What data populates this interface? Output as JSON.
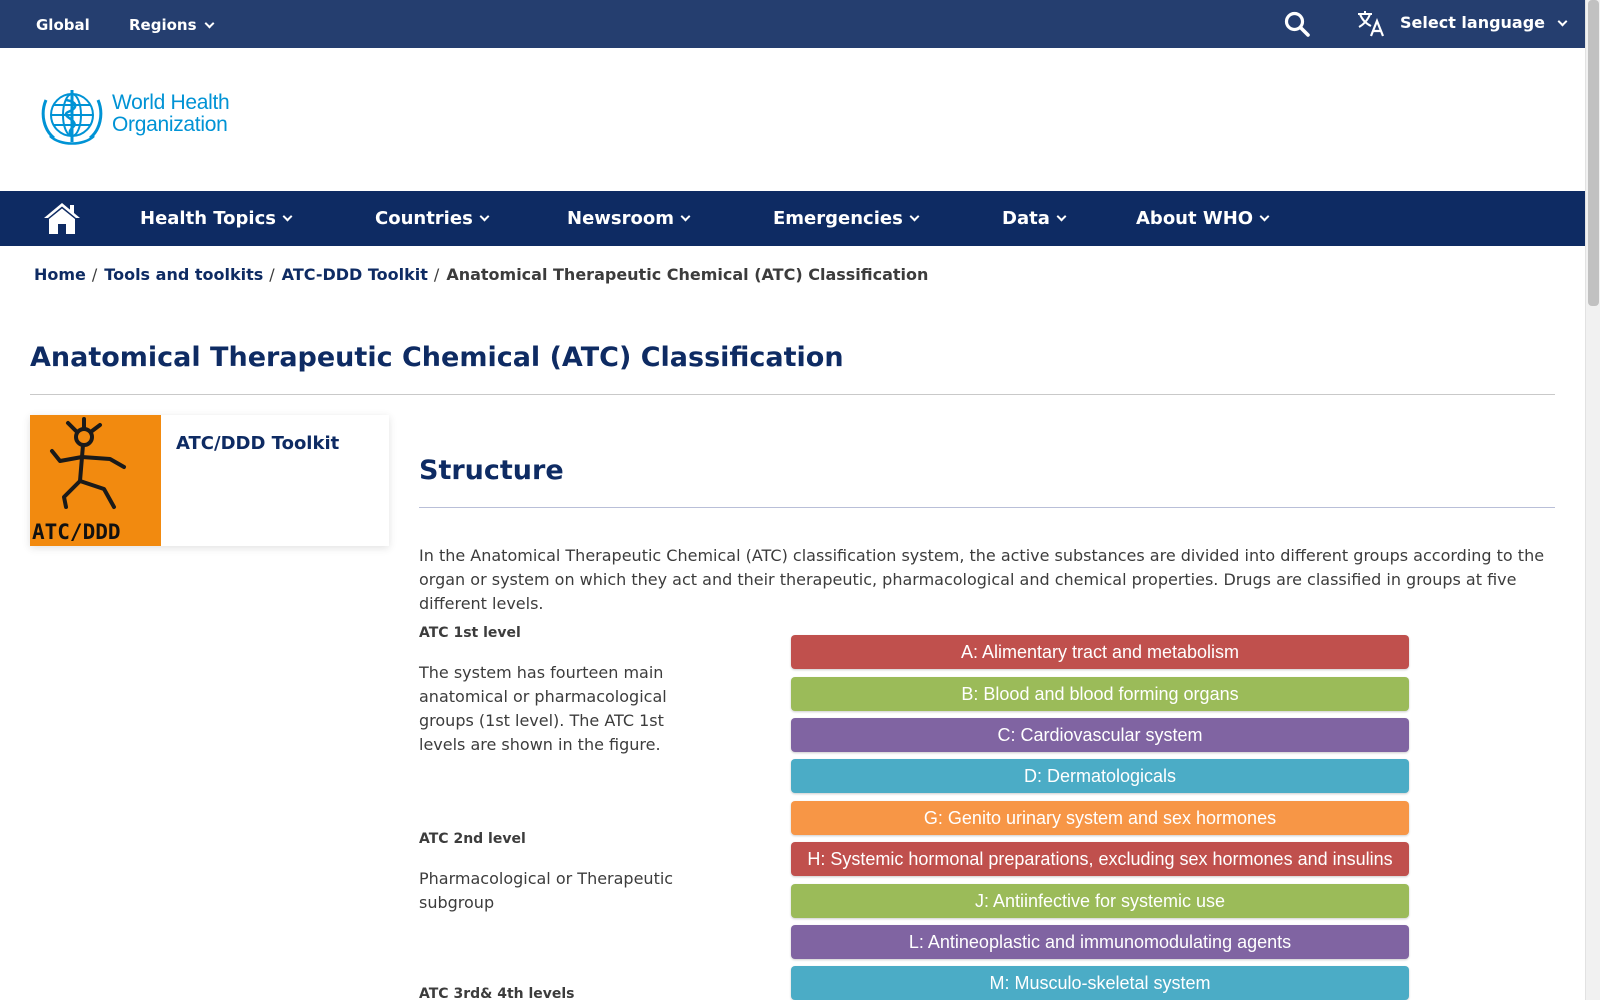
{
  "topbar": {
    "global": "Global",
    "regions": "Regions",
    "select_language": "Select language"
  },
  "logo": {
    "line1": "World Health",
    "line2": "Organization"
  },
  "nav": {
    "items": [
      {
        "label": "Health Topics"
      },
      {
        "label": "Countries"
      },
      {
        "label": "Newsroom"
      },
      {
        "label": "Emergencies"
      },
      {
        "label": "Data"
      },
      {
        "label": "About WHO"
      }
    ]
  },
  "breadcrumb": {
    "home": "Home",
    "tools": "Tools and toolkits",
    "toolkit": "ATC-DDD Toolkit",
    "current": "Anatomical Therapeutic Chemical (ATC) Classification"
  },
  "page": {
    "title": "Anatomical Therapeutic Chemical (ATC) Classification"
  },
  "sidebar": {
    "card_image_text": "ATC/DDD",
    "card_title": "ATC/DDD Toolkit"
  },
  "content": {
    "section_title": "Structure",
    "intro": "In the Anatomical Therapeutic Chemical (ATC) classification system, the active substances are divided into different groups according to the organ or system on which they act and their therapeutic, pharmacological and chemical properties. Drugs are classified in groups at five different levels.",
    "levels": [
      {
        "heading": "ATC 1st level",
        "text": "The system has fourteen main anatomical or pharmacological groups (1st level). The ATC 1st levels are shown in the figure."
      },
      {
        "heading": "ATC 2nd level",
        "text": "Pharmacological or Therapeutic subgroup"
      },
      {
        "heading": "ATC 3rd& 4th levels",
        "text": ""
      }
    ],
    "atc_groups": [
      {
        "label": "A: Alimentary tract and metabolism",
        "color": "#c0504d"
      },
      {
        "label": "B: Blood and blood forming organs",
        "color": "#9bbb59"
      },
      {
        "label": "C: Cardiovascular system",
        "color": "#8064a2"
      },
      {
        "label": "D: Dermatologicals",
        "color": "#4bacc6"
      },
      {
        "label": "G: Genito urinary system and sex hormones",
        "color": "#f79646"
      },
      {
        "label": "H: Systemic hormonal preparations, excluding sex hormones and insulins",
        "color": "#c0504d"
      },
      {
        "label": "J: Antiinfective for systemic use",
        "color": "#9bbb59"
      },
      {
        "label": "L: Antineoplastic and immunomodulating agents",
        "color": "#8064a2"
      },
      {
        "label": "M: Musculo-skeletal system",
        "color": "#4bacc6"
      }
    ]
  },
  "colors": {
    "topbar": "#253e6f",
    "nav": "#0e2b63",
    "brand_blue": "#0093d5",
    "card_orange": "#f28a0f"
  }
}
